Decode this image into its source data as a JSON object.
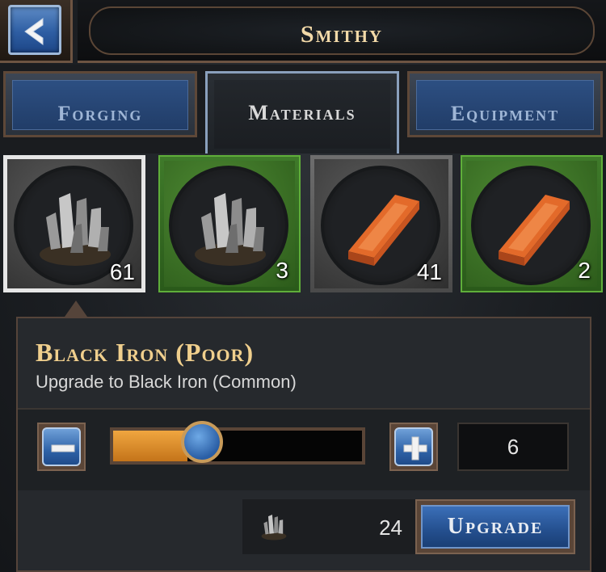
{
  "header": {
    "title": "Smithy",
    "back_icon": "arrow-left-icon"
  },
  "tabs": [
    {
      "label": "Forging",
      "active": false
    },
    {
      "label": "Materials",
      "active": true
    },
    {
      "label": "Equipment",
      "active": false
    }
  ],
  "materials": [
    {
      "icon": "black-iron-ore-icon",
      "count": "61",
      "state": "selected"
    },
    {
      "icon": "black-iron-ore-icon",
      "count": "3",
      "state": "green"
    },
    {
      "icon": "copper-ingot-icon",
      "count": "41",
      "state": "grey"
    },
    {
      "icon": "copper-ingot-icon",
      "count": "2",
      "state": "green"
    }
  ],
  "detail": {
    "name": "Black Iron (Poor)",
    "subtitle": "Upgrade to Black Iron (Common)",
    "quantity": "6",
    "slider_fraction": 0.3,
    "cost": "24",
    "upgrade_label": "Upgrade"
  },
  "colors": {
    "accent_gold": "#f0cf8d",
    "button_blue": "#2f63a8",
    "frame_brown": "#5a4537",
    "rarity_green": "#3f7a2a"
  }
}
